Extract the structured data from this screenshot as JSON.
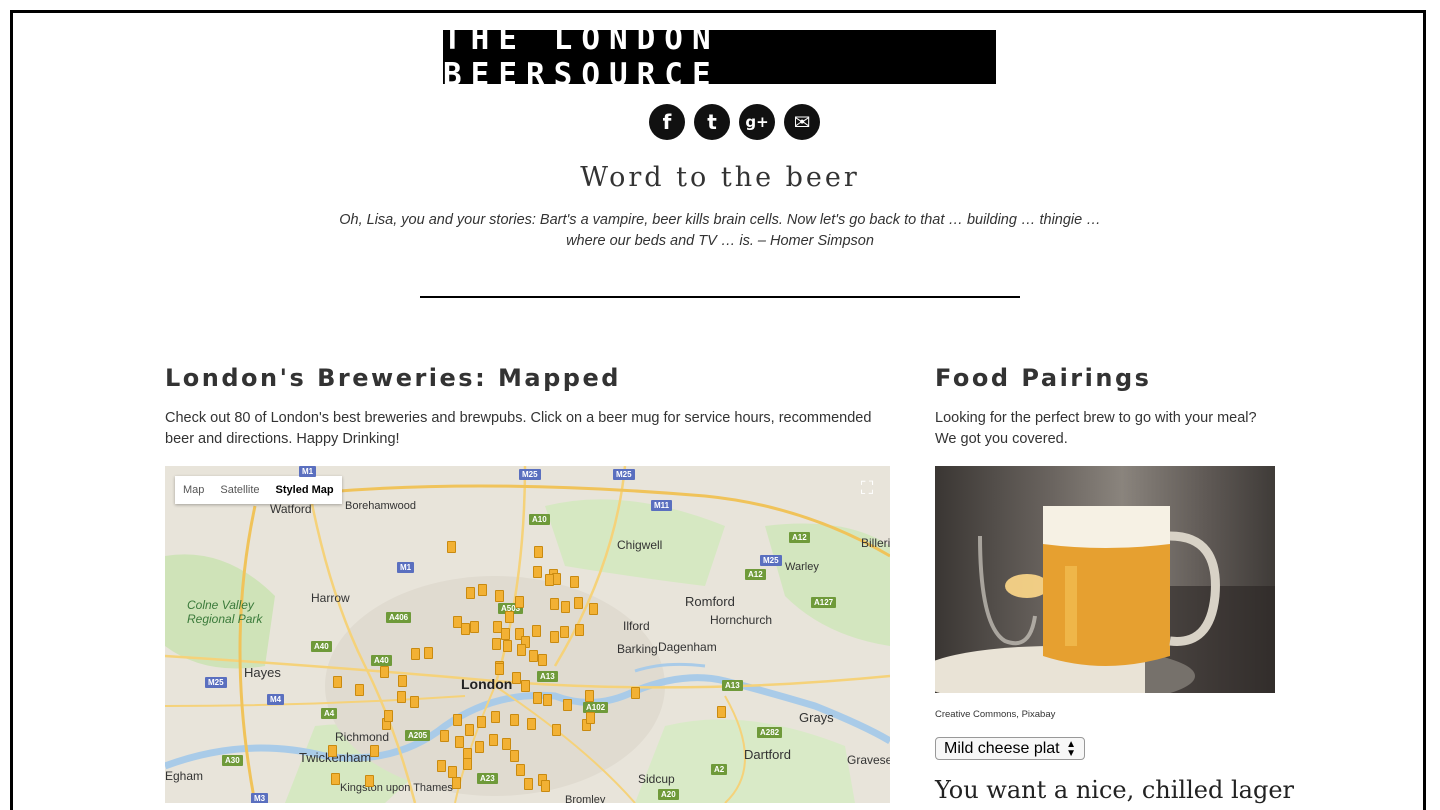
{
  "site": {
    "logo": "THE LONDON BEERSOURCE",
    "social": [
      {
        "name": "facebook-icon",
        "glyph": "f"
      },
      {
        "name": "twitter-icon",
        "glyph": "t"
      },
      {
        "name": "google-plus-icon",
        "glyph": "g+"
      },
      {
        "name": "email-icon",
        "glyph": "✉"
      }
    ],
    "tagline": "Word to the beer",
    "quote": "Oh, Lisa, you and your stories: Bart's a vampire, beer kills brain cells. Now let's go back to that … building … thingie … where our beds and TV … is. – Homer Simpson"
  },
  "breweries": {
    "heading": "London's Breweries: Mapped",
    "intro": "Check out 80 of London's best breweries and brewpubs. Click on a beer mug for service hours, recommended beer and directions. Happy Drinking!",
    "map": {
      "types": [
        "Map",
        "Satellite",
        "Styled Map"
      ],
      "selected": "Styled Map",
      "fullscreen_icon": "fullscreen-icon",
      "places": [
        "Watford",
        "Borehamwood",
        "Chigwell",
        "Billericay",
        "Warley",
        "Harrow",
        "Colne Valley Regional Park",
        "Romford",
        "Hornchurch",
        "Ilford",
        "Barking",
        "Dagenham",
        "Hayes",
        "London",
        "Grays",
        "Richmond",
        "Twickenham",
        "Dartford",
        "Gravesend",
        "Sidcup",
        "Egham",
        "Kingston upon Thames",
        "Bromley"
      ],
      "roads": [
        "M1",
        "M25",
        "M25",
        "M11",
        "A10",
        "A12",
        "M1",
        "M25",
        "A12",
        "A127",
        "A503",
        "A406",
        "A40",
        "A40",
        "M25",
        "M4",
        "A4",
        "A13",
        "A13",
        "A102",
        "A205",
        "A282",
        "A30",
        "A23",
        "A2",
        "A20",
        "M3"
      ]
    }
  },
  "food": {
    "heading": "Food Pairings",
    "intro": "Looking for the perfect brew to go with your meal? We got you covered.",
    "photo_credit": "Creative Commons, Pixabay",
    "selected_food": "Mild cheese plat",
    "pairing_text": "You want a nice, chilled lager"
  }
}
